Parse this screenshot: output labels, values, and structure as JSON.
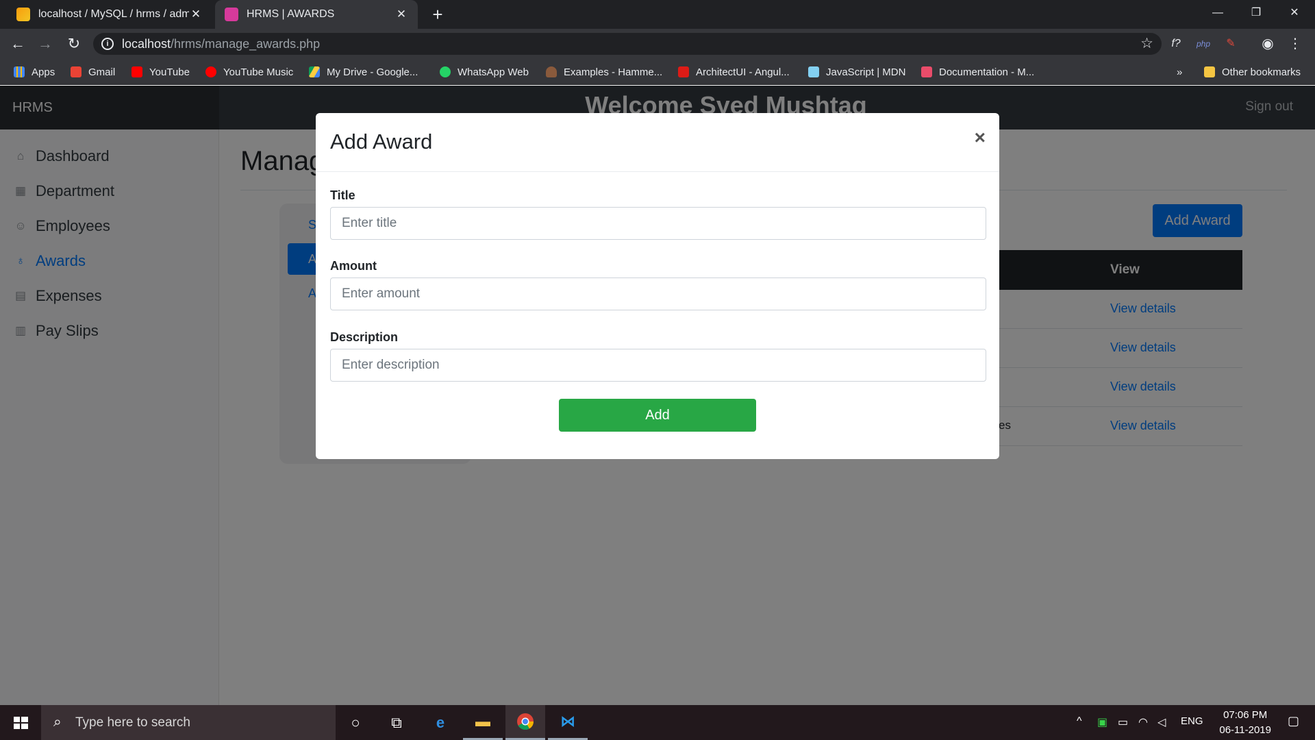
{
  "browser": {
    "tabs": [
      {
        "title": "localhost / MySQL / hrms / admi",
        "favicon": "phpmyadmin-icon"
      },
      {
        "title": "HRMS | AWARDS",
        "favicon": "app-icon"
      }
    ],
    "url_host": "localhost",
    "url_path": "/hrms/manage_awards.php",
    "bookmarks": [
      {
        "label": "Apps"
      },
      {
        "label": "Gmail"
      },
      {
        "label": "YouTube"
      },
      {
        "label": "YouTube Music"
      },
      {
        "label": "My Drive - Google..."
      },
      {
        "label": "WhatsApp Web"
      },
      {
        "label": "Examples - Hamme..."
      },
      {
        "label": "ArchitectUI - Angul..."
      },
      {
        "label": "JavaScript | MDN"
      },
      {
        "label": "Documentation - M..."
      }
    ],
    "overflow_label": "»",
    "other_bookmarks": "Other bookmarks"
  },
  "navbar": {
    "brand": "HRMS",
    "welcome": "Welcome Syed Mushtaq",
    "signout": "Sign out"
  },
  "sidebar": {
    "items": [
      {
        "label": "Dashboard",
        "icon": "home-icon"
      },
      {
        "label": "Department",
        "icon": "grid-icon"
      },
      {
        "label": "Employees",
        "icon": "users-icon"
      },
      {
        "label": "Awards",
        "icon": "award-icon",
        "active": true
      },
      {
        "label": "Expenses",
        "icon": "archive-icon"
      },
      {
        "label": "Pay Slips",
        "icon": "bar-chart-icon"
      }
    ]
  },
  "main": {
    "title_fragment": "Manag",
    "pills": [
      "Sta",
      "Aw",
      "Aw"
    ],
    "add_button": "Add Award",
    "table_header_view": "View",
    "row_fragment": "es",
    "view_links": [
      "View details",
      "View details",
      "View details",
      "View details"
    ]
  },
  "modal": {
    "title": "Add Award",
    "close": "×",
    "fields": {
      "title": {
        "label": "Title",
        "placeholder": "Enter title"
      },
      "amount": {
        "label": "Amount",
        "placeholder": "Enter amount"
      },
      "description": {
        "label": "Description",
        "placeholder": "Enter description"
      }
    },
    "submit": "Add"
  },
  "taskbar": {
    "search_placeholder": "Type here to search",
    "language": "ENG",
    "time": "07:06 PM",
    "date": "06-11-2019"
  },
  "colors": {
    "primary": "#007bff",
    "success": "#28a745",
    "navbar": "#343a40"
  }
}
